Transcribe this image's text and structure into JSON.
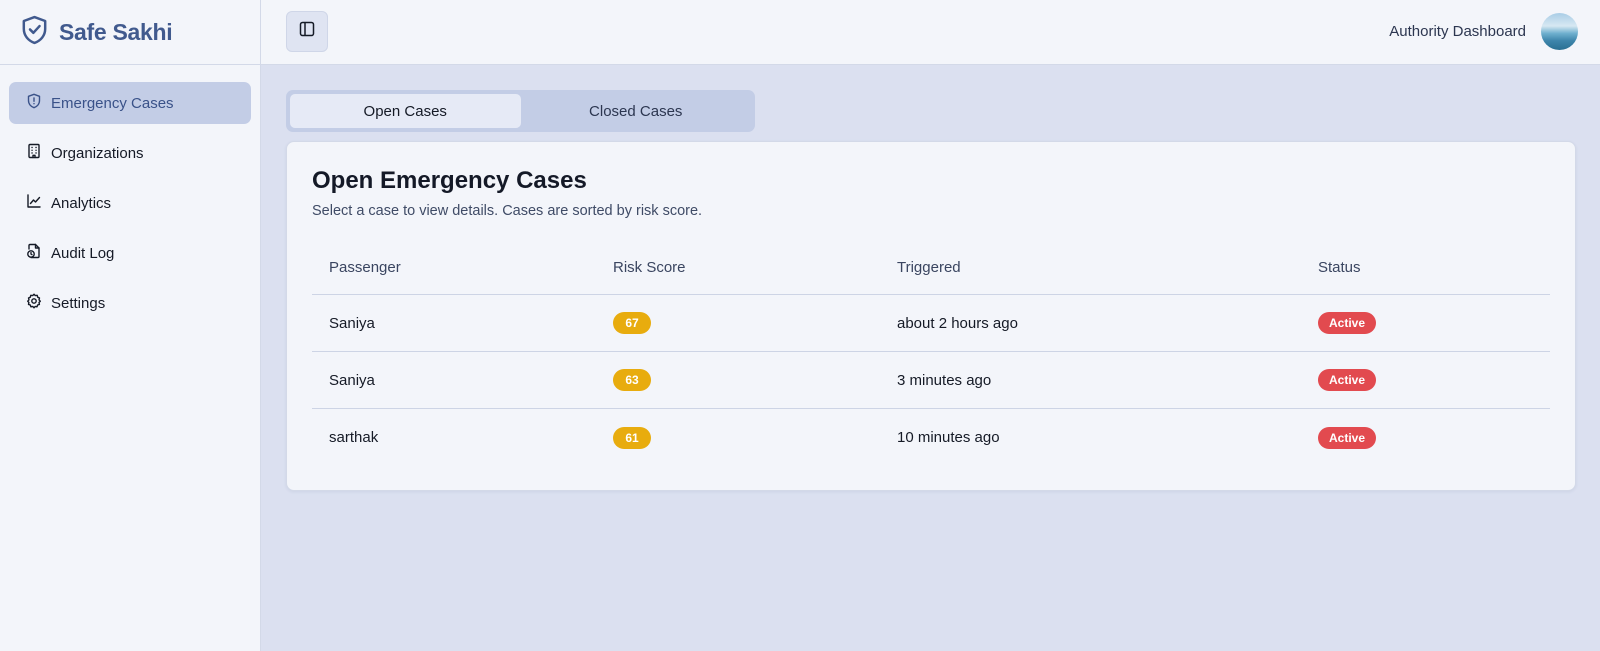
{
  "app": {
    "brand_name": "Safe Sakhi",
    "brand_icon": "shield-check-icon"
  },
  "sidebar": {
    "items": [
      {
        "label": "Emergency Cases",
        "icon": "shield-alert-icon",
        "active": true
      },
      {
        "label": "Organizations",
        "icon": "building-icon",
        "active": false
      },
      {
        "label": "Analytics",
        "icon": "line-chart-icon",
        "active": false
      },
      {
        "label": "Audit Log",
        "icon": "file-clock-icon",
        "active": false
      },
      {
        "label": "Settings",
        "icon": "gear-icon",
        "active": false
      }
    ]
  },
  "header": {
    "toggle_icon": "sidebar-toggle-icon",
    "title": "Authority Dashboard",
    "avatar": "user-avatar"
  },
  "tabs": [
    {
      "label": "Open Cases",
      "active": true
    },
    {
      "label": "Closed Cases",
      "active": false
    }
  ],
  "card": {
    "title": "Open Emergency Cases",
    "subtitle": "Select a case to view details. Cases are sorted by risk score."
  },
  "table": {
    "columns": [
      "Passenger",
      "Risk Score",
      "Triggered",
      "Status"
    ],
    "rows": [
      {
        "passenger": "Saniya",
        "risk_score": "67",
        "triggered": "about 2 hours ago",
        "status": "Active"
      },
      {
        "passenger": "Saniya",
        "risk_score": "63",
        "triggered": "3 minutes ago",
        "status": "Active"
      },
      {
        "passenger": "sarthak",
        "risk_score": "61",
        "triggered": "10 minutes ago",
        "status": "Active"
      }
    ]
  },
  "colors": {
    "brand": "#415a8e",
    "active_nav_bg": "#c3cde6",
    "risk_badge": "#e8ac0e",
    "status_active": "#e24a4f",
    "page_bg": "#dbe0f0"
  }
}
